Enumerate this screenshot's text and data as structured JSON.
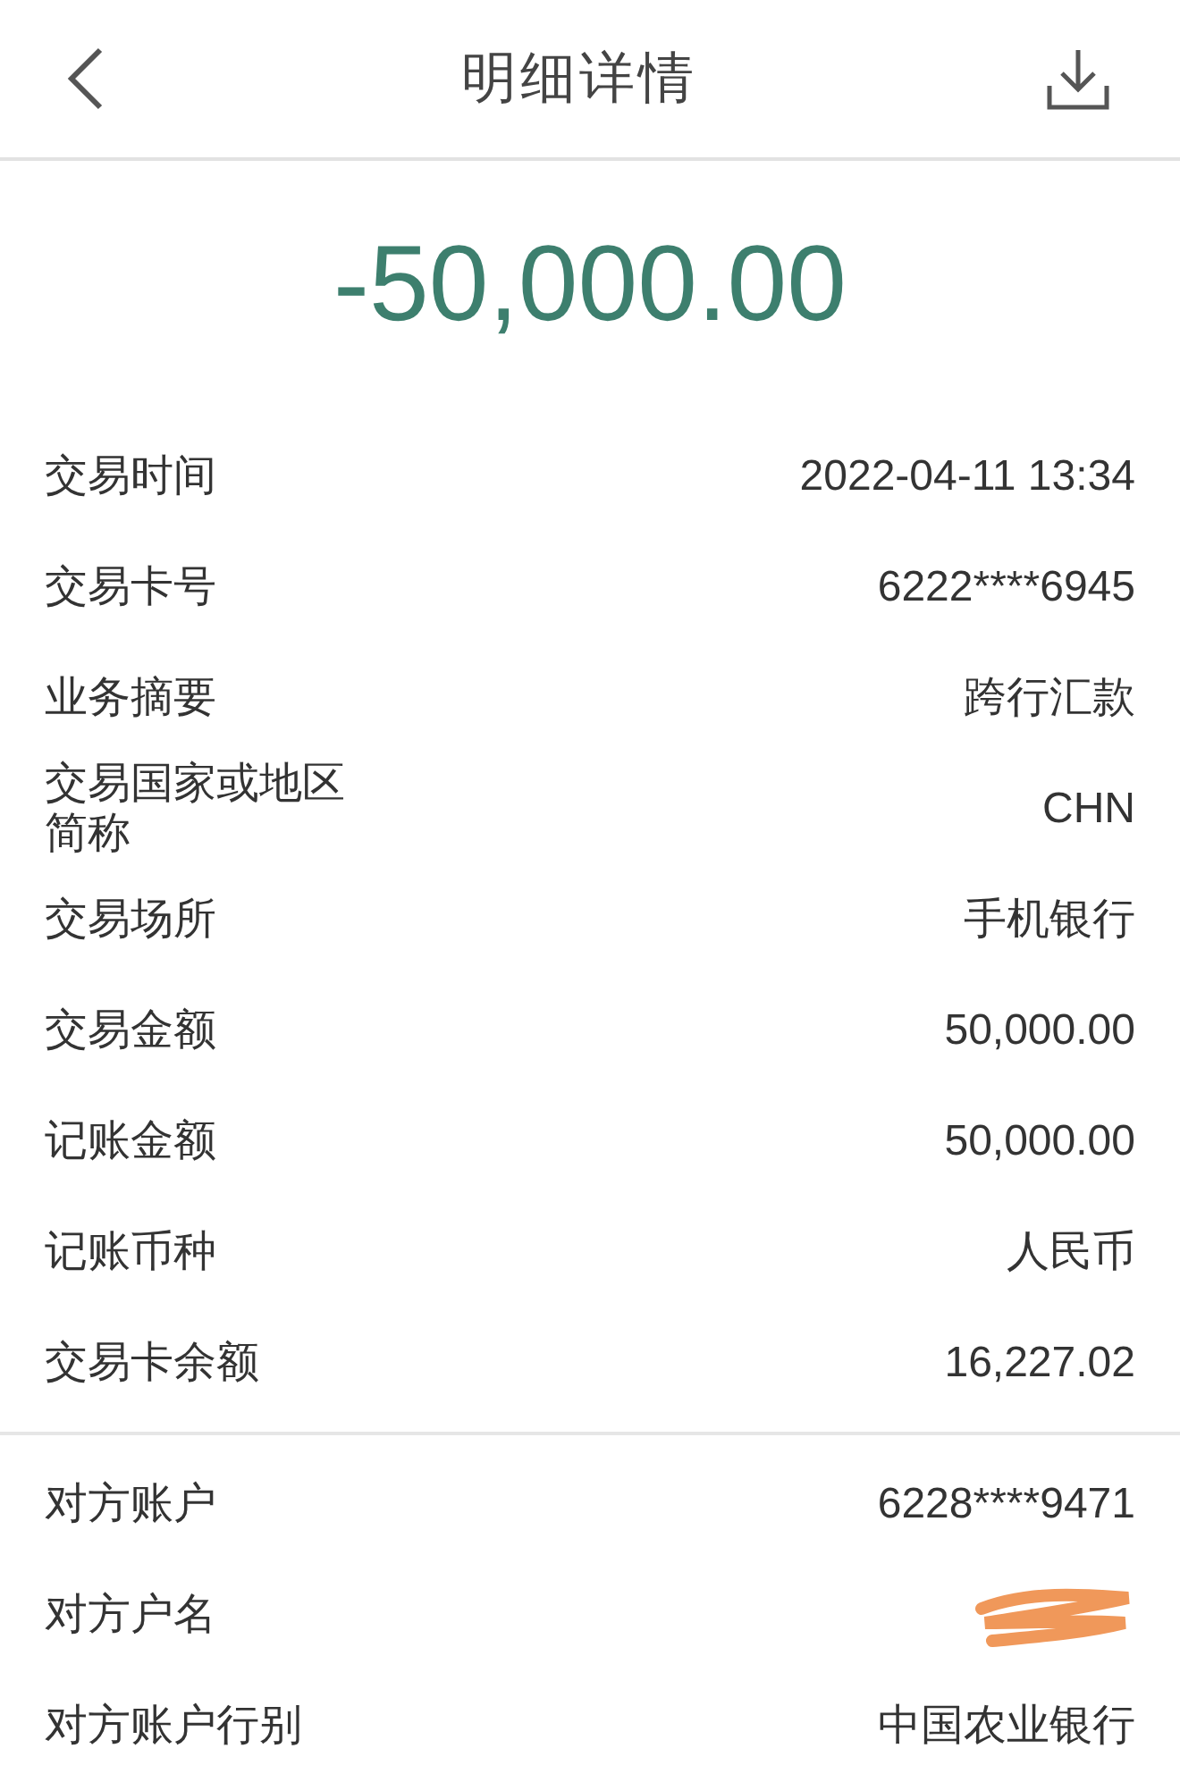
{
  "header": {
    "title": "明细详情"
  },
  "amount": "-50,000.00",
  "sections": [
    {
      "rows": [
        {
          "label": "交易时间",
          "value": "2022-04-11 13:34"
        },
        {
          "label": "交易卡号",
          "value": "6222****6945"
        },
        {
          "label": "业务摘要",
          "value": "跨行汇款"
        },
        {
          "label": "交易国家或地区简称",
          "value": "CHN"
        },
        {
          "label": "交易场所",
          "value": "手机银行"
        },
        {
          "label": "交易金额",
          "value": "50,000.00"
        },
        {
          "label": "记账金额",
          "value": "50,000.00"
        },
        {
          "label": "记账币种",
          "value": "人民币"
        },
        {
          "label": "交易卡余额",
          "value": "16,227.02"
        }
      ]
    },
    {
      "rows": [
        {
          "label": "对方账户",
          "value": "6228****9471"
        },
        {
          "label": "对方户名",
          "redacted": true
        },
        {
          "label": "对方账户行别",
          "value": "中国农业银行"
        }
      ]
    }
  ]
}
